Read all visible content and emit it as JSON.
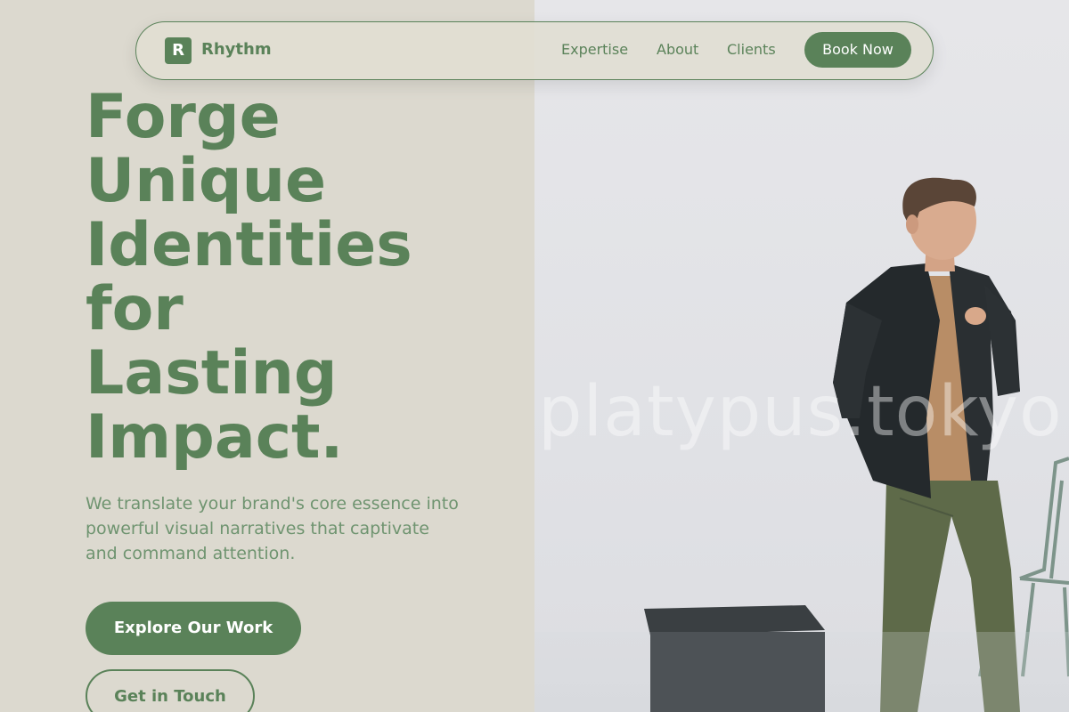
{
  "brand": {
    "logo_letter": "R",
    "name": "Rhythm"
  },
  "nav": {
    "links": [
      "Expertise",
      "About",
      "Clients"
    ],
    "cta": "Book Now"
  },
  "hero": {
    "title_lines": [
      "Forge",
      "Unique",
      "Identities",
      "for",
      "Lasting",
      "Impact."
    ],
    "description": "We translate your brand's core essence into powerful visual narratives that captivate and command attention.",
    "primary_button": "Explore Our Work",
    "secondary_button": "Get in Touch"
  },
  "media": {
    "watermark": "platypus.tokyo"
  },
  "colors": {
    "accent": "#5a8259",
    "background": "#dcd9cf",
    "text_light": "#ffffff"
  }
}
